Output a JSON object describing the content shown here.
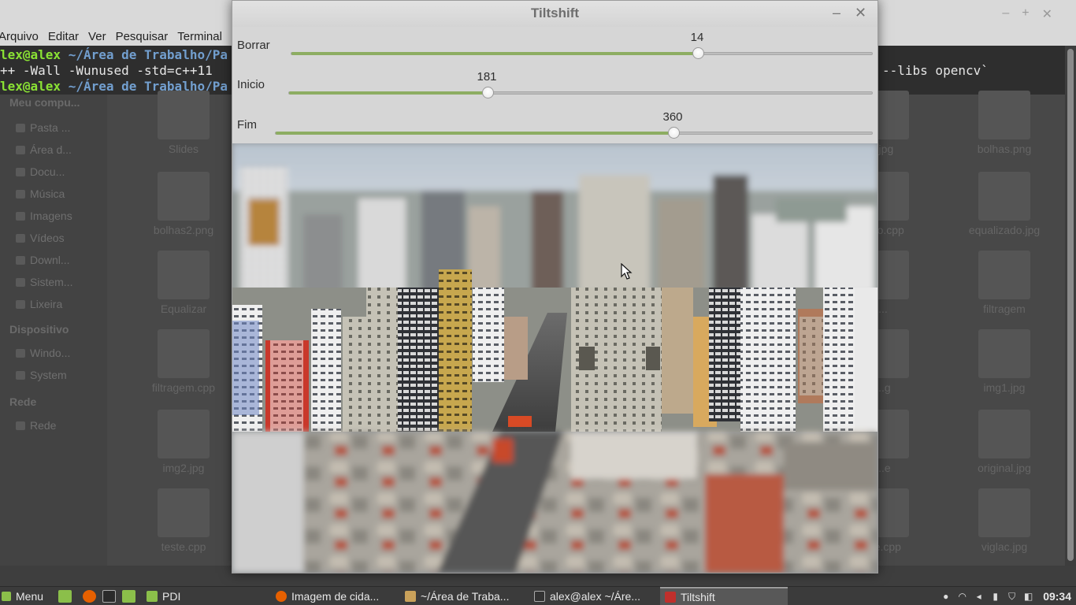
{
  "background_terminal": {
    "menu": [
      "Arquivo",
      "Editar",
      "Ver",
      "Pesquisar",
      "Terminal"
    ],
    "lines": [
      {
        "user": "lex@alex",
        "path": " ~/Área de Trabalho/Pa",
        "rest": ""
      },
      {
        "user": "",
        "path": "",
        "rest": "++ -Wall -Wunused -std=c++11"
      },
      {
        "user": "lex@alex",
        "path": " ~/Área de Trabalho/Pa",
        "rest": ""
      }
    ],
    "right_text": "--libs opencv`"
  },
  "file_manager": {
    "sidebar": [
      {
        "label": "Meu compu...",
        "type": "head"
      },
      {
        "label": "Pasta ...",
        "type": "item"
      },
      {
        "label": "Área d...",
        "type": "item"
      },
      {
        "label": "Docu...",
        "type": "item"
      },
      {
        "label": "Música",
        "type": "item"
      },
      {
        "label": "Imagens",
        "type": "item"
      },
      {
        "label": "Vídeos",
        "type": "item"
      },
      {
        "label": "Downl...",
        "type": "item"
      },
      {
        "label": "Sistem...",
        "type": "item"
      },
      {
        "label": "Lixeira",
        "type": "item"
      },
      {
        "label": "Dispositivo",
        "type": "head"
      },
      {
        "label": "Windo...",
        "type": "item"
      },
      {
        "label": "System",
        "type": "item"
      },
      {
        "label": "Rede",
        "type": "head"
      },
      {
        "label": "Rede",
        "type": "item"
      }
    ],
    "files_left": [
      "Slides",
      "bolhas2.png",
      "Equalizar",
      "filtragem.cpp",
      "img2.jpg",
      "teste.cpp"
    ],
    "files_mid": [
      "..jpg",
      "_\n..o.cpp",
      "...",
      "...g",
      "...e",
      "...e.cpp"
    ],
    "files_right": [
      "bolhas.png",
      "equalizado.jpg",
      "filtragem",
      "img1.jpg",
      "original.jpg",
      "viglac.jpg"
    ]
  },
  "tiltshift": {
    "title": "Tiltshift",
    "min_glyph": "–",
    "close_glyph": "✕",
    "trackbars": [
      {
        "label": "Borrar",
        "value": "14",
        "fraction": 0.7
      },
      {
        "label": "Inicio",
        "value": "181",
        "fraction": 0.34
      },
      {
        "label": "Fim",
        "value": "360",
        "fraction": 0.667
      }
    ]
  },
  "taskbar": {
    "menu_label": "Menu",
    "tasks": [
      {
        "label": "PDI",
        "icon": "folder-icon",
        "color": "#8bbf4a"
      },
      {
        "label": "Imagem de cida...",
        "icon": "firefox-icon",
        "color": "#e66000"
      },
      {
        "label": "~/Área de Traba...",
        "icon": "editor-icon",
        "color": "#c9a15a"
      },
      {
        "label": "alex@alex ~/Áre...",
        "icon": "terminal-icon",
        "color": "#333333"
      },
      {
        "label": "Tiltshift",
        "icon": "opencv-window-icon",
        "color": "#c0302c"
      }
    ],
    "clock": "09:34"
  },
  "colors": {
    "accent_green": "#8dad62",
    "prompt_user": "#8ae234",
    "prompt_path": "#729fcf"
  }
}
